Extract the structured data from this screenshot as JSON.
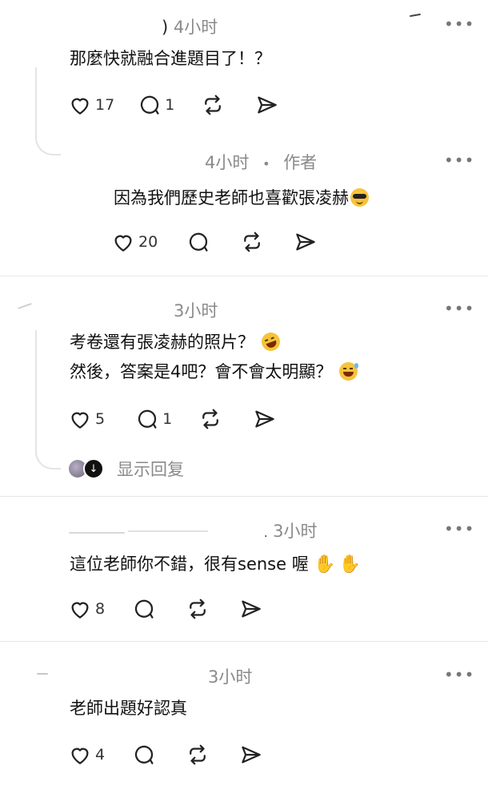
{
  "comments": [
    {
      "time": "4小时",
      "text": "那麼快就融合進題目了！？",
      "likes": "17",
      "replies": "1"
    },
    {
      "time": "4小时",
      "author_badge": "作者",
      "text": "因為我們歷史老師也喜歡張凌赫",
      "likes": "20"
    },
    {
      "time": "3小时",
      "text_line1": "考卷還有張凌赫的照片？",
      "text_line2": "然後，答案是4吧？會不會太明顯？",
      "likes": "5",
      "replies": "1",
      "show_replies": "显示回复"
    },
    {
      "time": "3小时",
      "text": "這位老師你不錯，很有sense 喔",
      "likes": "8"
    },
    {
      "time": "3小时",
      "text": "老師出題好認真",
      "likes": "4"
    }
  ],
  "icons": [
    "heart-icon",
    "comment-icon",
    "repost-icon",
    "share-icon",
    "more-icon"
  ],
  "colors": {
    "text": "#111111",
    "meta": "#8a8a8a",
    "divider": "#e7e7e7"
  }
}
